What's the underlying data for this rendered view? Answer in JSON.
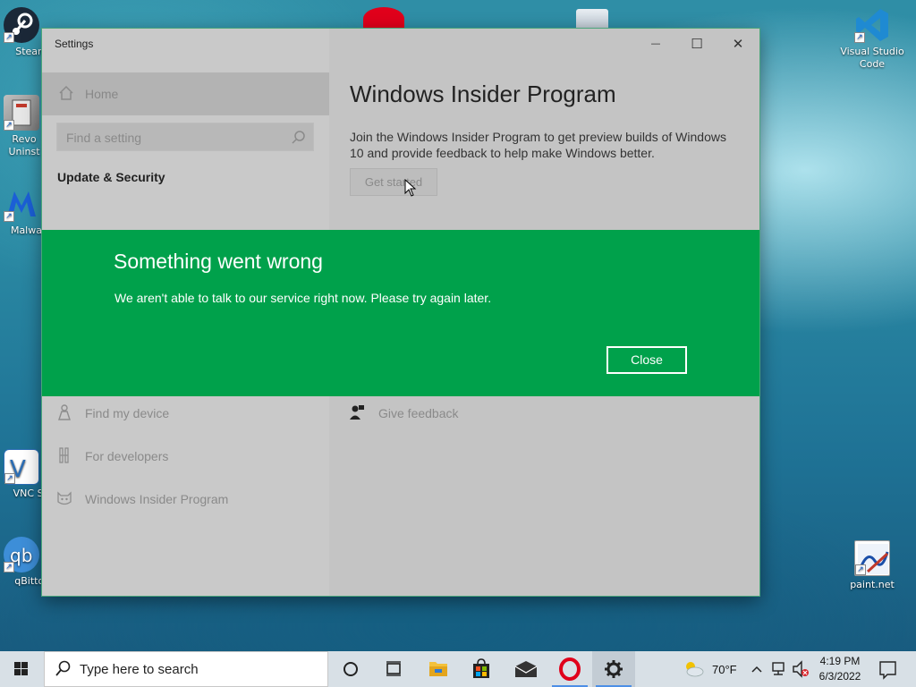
{
  "desktop": {
    "icons_left": [
      {
        "label": "Steam",
        "name": "steam"
      },
      {
        "label": "Revo Uninst",
        "name": "revo-uninstaller"
      },
      {
        "label": "Malware",
        "name": "malwarebytes"
      },
      {
        "label": "VNC Se",
        "name": "vnc-server"
      },
      {
        "label": "qBittor",
        "name": "qbittorrent"
      }
    ],
    "icons_right": [
      {
        "label": "Visual Studio Code",
        "name": "visual-studio-code"
      },
      {
        "label": "paint.net",
        "name": "paint-net"
      }
    ]
  },
  "window": {
    "title": "Settings",
    "controls": {
      "minimize": "—",
      "maximize": "☐",
      "close": "✕"
    },
    "sidebar": {
      "home_label": "Home",
      "search_placeholder": "Find a setting",
      "section_title": "Update & Security",
      "items": [
        {
          "label": "Find my device",
          "icon": "person-location-icon"
        },
        {
          "label": "For developers",
          "icon": "developer-tools-icon"
        },
        {
          "label": "Windows Insider Program",
          "icon": "insider-cat-icon"
        }
      ]
    },
    "main": {
      "title": "Windows Insider Program",
      "description": "Join the Windows Insider Program to get preview builds of Windows 10 and provide feedback to help make Windows better.",
      "get_started_label": "Get started",
      "feedback_label": "Give feedback"
    }
  },
  "dialog": {
    "title": "Something went wrong",
    "message": "We aren't able to talk to our service right now. Please try again later.",
    "close_label": "Close",
    "color": "#00a14b"
  },
  "taskbar": {
    "search_placeholder": "Type here to search",
    "apps": [
      "cortana",
      "task-view",
      "file-explorer",
      "microsoft-store",
      "mail",
      "opera",
      "settings"
    ],
    "weather": "70°F",
    "time": "4:19 PM",
    "date": "6/3/2022"
  }
}
